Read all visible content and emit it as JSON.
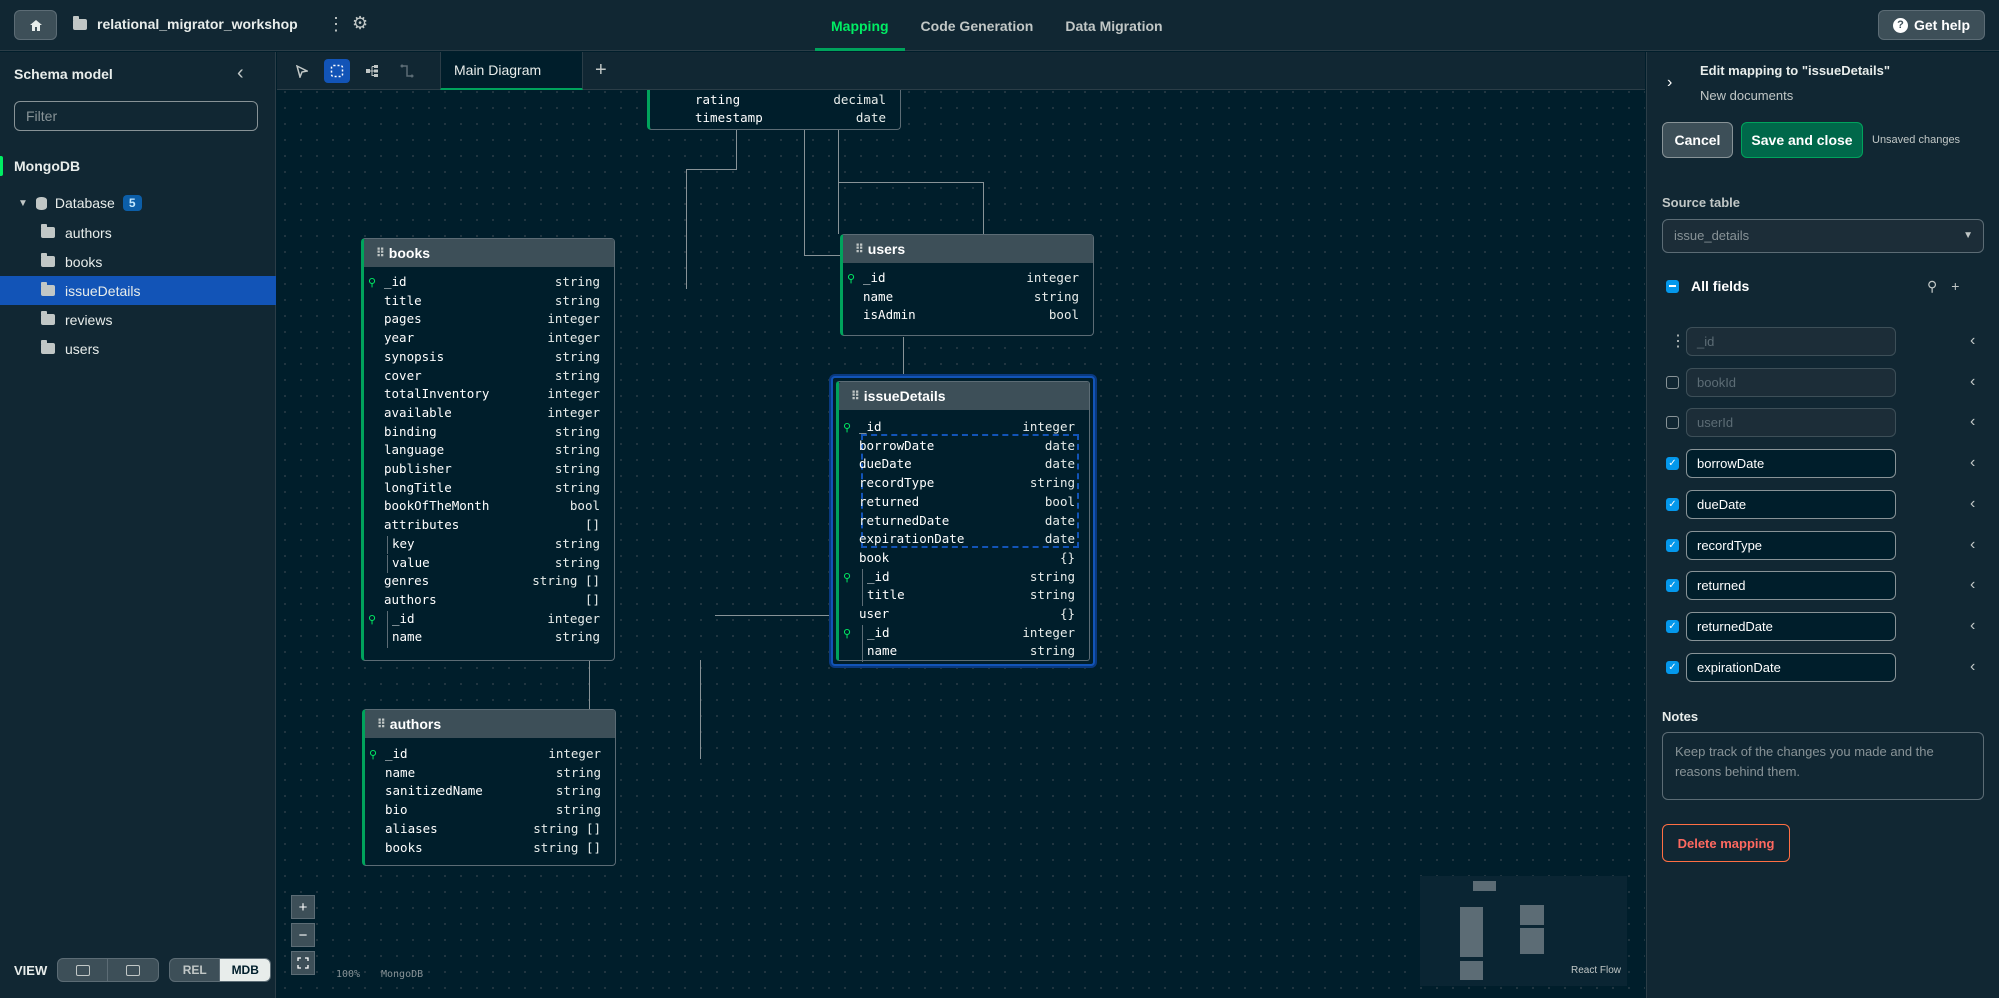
{
  "topbar": {
    "project_name": "relational_migrator_workshop",
    "tabs": [
      "Mapping",
      "Code Generation",
      "Data Migration"
    ],
    "active_tab": "Mapping",
    "help_label": "Get help"
  },
  "sidebar": {
    "title": "Schema model",
    "filter_placeholder": "Filter",
    "source": "MongoDB",
    "database_label": "Database",
    "database_count": "5",
    "collections": [
      "authors",
      "books",
      "issueDetails",
      "reviews",
      "users"
    ],
    "active_collection": "issueDetails",
    "view_label": "VIEW",
    "view_options": [
      "REL",
      "MDB"
    ],
    "active_view": "MDB"
  },
  "canvas": {
    "tab_label": "Main Diagram",
    "zoom_level": "100%",
    "mode_label": "MongoDB",
    "attribution": "React Flow",
    "nodes": {
      "reviews": {
        "fields": [
          {
            "name": "rating",
            "type": "decimal"
          },
          {
            "name": "timestamp",
            "type": "date"
          }
        ]
      },
      "books": {
        "title": "books",
        "fields": [
          {
            "name": "_id",
            "type": "string",
            "key": true
          },
          {
            "name": "title",
            "type": "string"
          },
          {
            "name": "pages",
            "type": "integer"
          },
          {
            "name": "year",
            "type": "integer"
          },
          {
            "name": "synopsis",
            "type": "string"
          },
          {
            "name": "cover",
            "type": "string"
          },
          {
            "name": "totalInventory",
            "type": "integer"
          },
          {
            "name": "available",
            "type": "integer"
          },
          {
            "name": "binding",
            "type": "string"
          },
          {
            "name": "language",
            "type": "string"
          },
          {
            "name": "publisher",
            "type": "string"
          },
          {
            "name": "longTitle",
            "type": "string"
          },
          {
            "name": "bookOfTheMonth",
            "type": "bool"
          },
          {
            "name": "attributes",
            "type": "[]"
          },
          {
            "name": "key",
            "type": "string",
            "nested": true
          },
          {
            "name": "value",
            "type": "string",
            "nested": true
          },
          {
            "name": "genres",
            "type": "string []"
          },
          {
            "name": "authors",
            "type": "[]"
          },
          {
            "name": "_id",
            "type": "integer",
            "nested": true,
            "key": true
          },
          {
            "name": "name",
            "type": "string",
            "nested": true
          }
        ]
      },
      "users": {
        "title": "users",
        "fields": [
          {
            "name": "_id",
            "type": "integer",
            "key": true
          },
          {
            "name": "name",
            "type": "string"
          },
          {
            "name": "isAdmin",
            "type": "bool"
          }
        ]
      },
      "issueDetails": {
        "title": "issueDetails",
        "fields": [
          {
            "name": "_id",
            "type": "integer",
            "key": true
          },
          {
            "name": "borrowDate",
            "type": "date"
          },
          {
            "name": "dueDate",
            "type": "date"
          },
          {
            "name": "recordType",
            "type": "string"
          },
          {
            "name": "returned",
            "type": "bool"
          },
          {
            "name": "returnedDate",
            "type": "date"
          },
          {
            "name": "expirationDate",
            "type": "date"
          },
          {
            "name": "book",
            "type": "{}"
          },
          {
            "name": "_id",
            "type": "string",
            "nested": true,
            "key": true
          },
          {
            "name": "title",
            "type": "string",
            "nested": true
          },
          {
            "name": "user",
            "type": "{}"
          },
          {
            "name": "_id",
            "type": "integer",
            "nested": true,
            "key": true
          },
          {
            "name": "name",
            "type": "string",
            "nested": true
          }
        ]
      },
      "authors": {
        "title": "authors",
        "fields": [
          {
            "name": "_id",
            "type": "integer",
            "key": true
          },
          {
            "name": "name",
            "type": "string"
          },
          {
            "name": "sanitizedName",
            "type": "string"
          },
          {
            "name": "bio",
            "type": "string"
          },
          {
            "name": "aliases",
            "type": "string []"
          },
          {
            "name": "books",
            "type": "string []"
          }
        ]
      }
    }
  },
  "panel": {
    "title": "Edit mapping to \"issueDetails\"",
    "subtitle": "New documents",
    "cancel_label": "Cancel",
    "save_label": "Save and close",
    "unsaved_label": "Unsaved changes",
    "source_table_label": "Source table",
    "source_table_value": "issue_details",
    "all_fields_label": "All fields",
    "fields": [
      {
        "name": "_id",
        "checked": false,
        "disabled": true,
        "kebab": true
      },
      {
        "name": "bookId",
        "checked": false,
        "disabled": true
      },
      {
        "name": "userId",
        "checked": false,
        "disabled": true
      },
      {
        "name": "borrowDate",
        "checked": true,
        "disabled": false
      },
      {
        "name": "dueDate",
        "checked": true,
        "disabled": false
      },
      {
        "name": "recordType",
        "checked": true,
        "disabled": false
      },
      {
        "name": "returned",
        "checked": true,
        "disabled": false
      },
      {
        "name": "returnedDate",
        "checked": true,
        "disabled": false
      },
      {
        "name": "expirationDate",
        "checked": true,
        "disabled": false
      }
    ],
    "notes_label": "Notes",
    "notes_placeholder": "Keep track of the changes you made and the reasons behind them.",
    "delete_label": "Delete mapping"
  },
  "colors": {
    "accent_green": "#00ed64",
    "selection_blue": "#1254b7",
    "background": "#001e2b",
    "danger": "#ff6960"
  }
}
